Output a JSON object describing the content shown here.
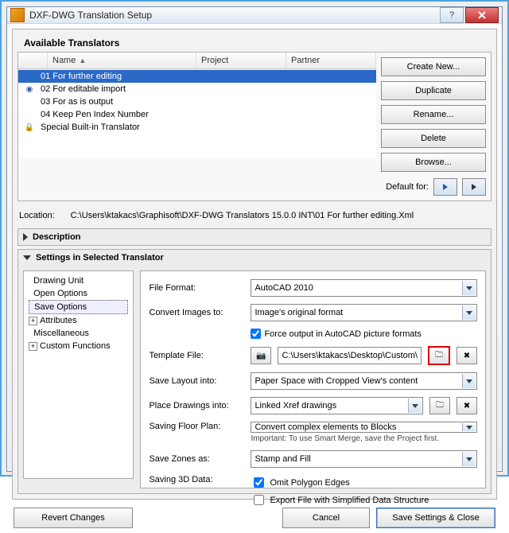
{
  "window": {
    "title": "DXF-DWG Translation Setup"
  },
  "available": {
    "heading": "Available Translators",
    "cols": {
      "name": "Name",
      "project": "Project",
      "partner": "Partner"
    },
    "rows": [
      {
        "icon": "",
        "text": "01 For further editing",
        "selected": true
      },
      {
        "icon": "globe",
        "text": "02 For editable import"
      },
      {
        "icon": "",
        "text": "03 For as is output"
      },
      {
        "icon": "",
        "text": "04 Keep Pen Index Number"
      },
      {
        "icon": "lock",
        "text": "Special Built-in Translator"
      }
    ]
  },
  "buttons": {
    "create": "Create New...",
    "duplicate": "Duplicate",
    "rename": "Rename...",
    "delete": "Delete",
    "browse": "Browse...",
    "default_for": "Default for:"
  },
  "location": {
    "label": "Location:",
    "path": "C:\\Users\\ktakacs\\Graphisoft\\DXF-DWG Translators 15.0.0 INT\\01 For further editing.Xml"
  },
  "panels": {
    "description": "Description",
    "settings": "Settings in Selected Translator"
  },
  "tree": {
    "items": [
      {
        "label": "Drawing Unit"
      },
      {
        "label": "Open Options"
      },
      {
        "label": "Save Options",
        "selected": true
      },
      {
        "label": "Attributes",
        "expandable": true
      },
      {
        "label": "Miscellaneous"
      },
      {
        "label": "Custom Functions",
        "expandable": true
      }
    ]
  },
  "form": {
    "file_format": {
      "label": "File Format:",
      "value": "AutoCAD 2010"
    },
    "convert_images": {
      "label": "Convert Images to:",
      "value": "Image's original format"
    },
    "force_output": {
      "label": "Force output in AutoCAD picture formats",
      "checked": true
    },
    "template_file": {
      "label": "Template File:",
      "value": "C:\\Users\\ktakacs\\Desktop\\Custom\\"
    },
    "save_layout": {
      "label": "Save Layout into:",
      "value": "Paper Space with Cropped View's content"
    },
    "place_drawings": {
      "label": "Place Drawings into:",
      "value": "Linked Xref drawings"
    },
    "floor_plan": {
      "label": "Saving Floor Plan:",
      "value": "Convert complex elements to Blocks",
      "note": "Important: To use Smart Merge, save the Project first."
    },
    "zones": {
      "label": "Save Zones as:",
      "value": "Stamp and Fill"
    },
    "saving_3d": {
      "label": "Saving 3D Data:"
    },
    "omit_poly": {
      "label": "Omit Polygon Edges",
      "checked": true
    },
    "simplified": {
      "label": "Export File with Simplified Data Structure",
      "checked": false
    }
  },
  "footer": {
    "revert": "Revert Changes",
    "cancel": "Cancel",
    "save": "Save Settings & Close"
  }
}
